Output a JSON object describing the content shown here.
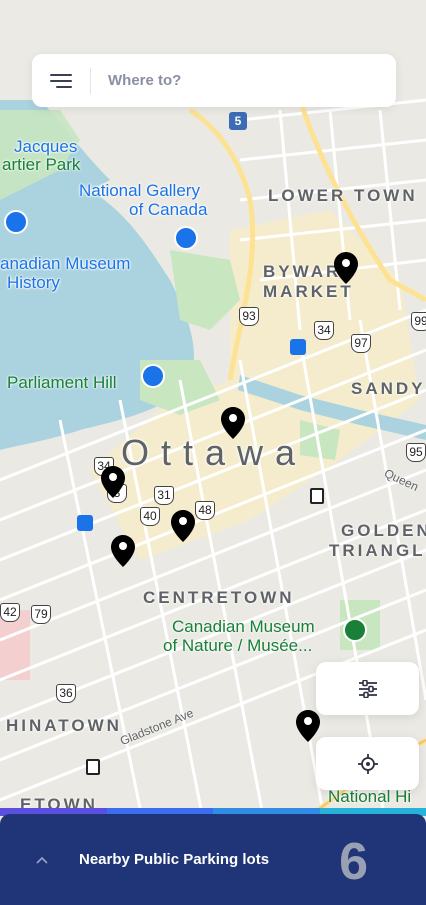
{
  "search": {
    "placeholder": "Where to?"
  },
  "map": {
    "city_label": "Ottawa",
    "places": {
      "jacques_cartier_1": "Jacques",
      "jacques_cartier_2": "artier Park",
      "national_gallery_1": "National Gallery",
      "national_gallery_2": "of Canada",
      "history_museum_1": "anadian Museum",
      "history_museum_2": "History",
      "parliament_hill": "Parliament Hill",
      "nature_museum_1": "Canadian Museum",
      "nature_museum_2": "of Nature / Musée...",
      "national_hi": "National Hi"
    },
    "neighbourhoods": {
      "lower_town": "LOWER TOWN",
      "byward_1": "BYWARD",
      "byward_2": "MARKET",
      "sandy": "SANDY",
      "golden_1": "GOLDEN",
      "golden_2": "TRIANGLE",
      "centretown": "CENTRETOWN",
      "chinatown": "HINATOWN",
      "bottom_cut": "ETOWN"
    },
    "streets": {
      "gladstone": "Gladstone Ave",
      "queen": "Queen"
    },
    "route_shields": [
      "5",
      "93",
      "34",
      "97",
      "99",
      "95",
      "34",
      "3",
      "31",
      "40",
      "48",
      "42",
      "79",
      "36"
    ],
    "pins_count": 6,
    "colors": {
      "water": "#aad3df",
      "park": "#c8e6c0",
      "block": "#f5f0e1",
      "road": "#ffffff",
      "arterial": "#fde293"
    }
  },
  "controls": {
    "filter_icon": "sliders-icon",
    "locate_icon": "crosshair-icon"
  },
  "bottom_sheet": {
    "title": "Nearby Public Parking lots",
    "count": "6",
    "colors": {
      "background": "#1f3577",
      "count": "#9aa0b3"
    }
  }
}
